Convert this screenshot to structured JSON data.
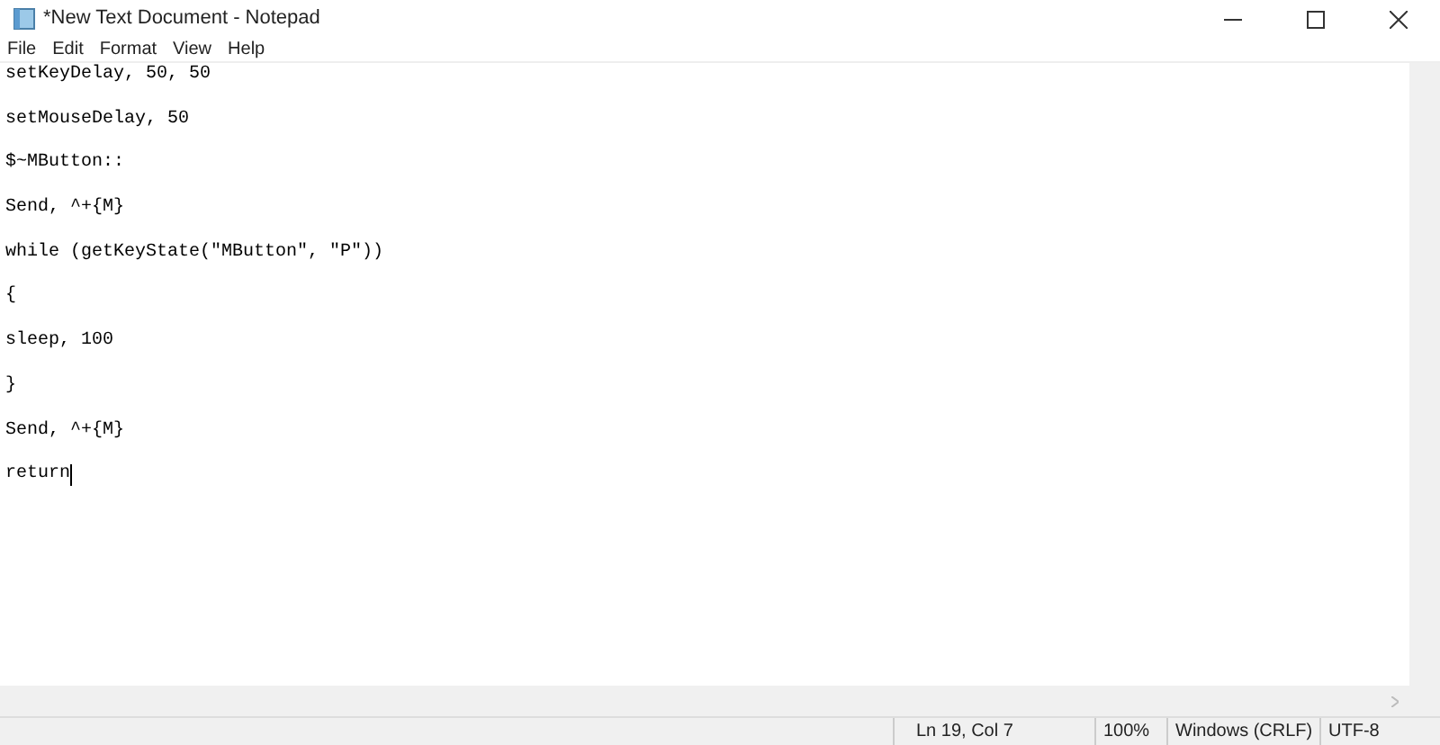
{
  "window": {
    "title": "*New Text Document - Notepad"
  },
  "menu": [
    "File",
    "Edit",
    "Format",
    "View",
    "Help"
  ],
  "editor": {
    "lines": [
      "setKeyDelay, 50, 50",
      "setMouseDelay, 50",
      "$~MButton::",
      "Send, ^+{M}",
      "while (getKeyState(\"MButton\", \"P\"))",
      "{",
      "sleep, 100",
      "}",
      "Send, ^+{M}",
      "return"
    ]
  },
  "status_bar": {
    "position": "Ln 19, Col 7",
    "zoom": "100%",
    "line_ending": "Windows (CRLF)",
    "encoding": "UTF-8"
  }
}
